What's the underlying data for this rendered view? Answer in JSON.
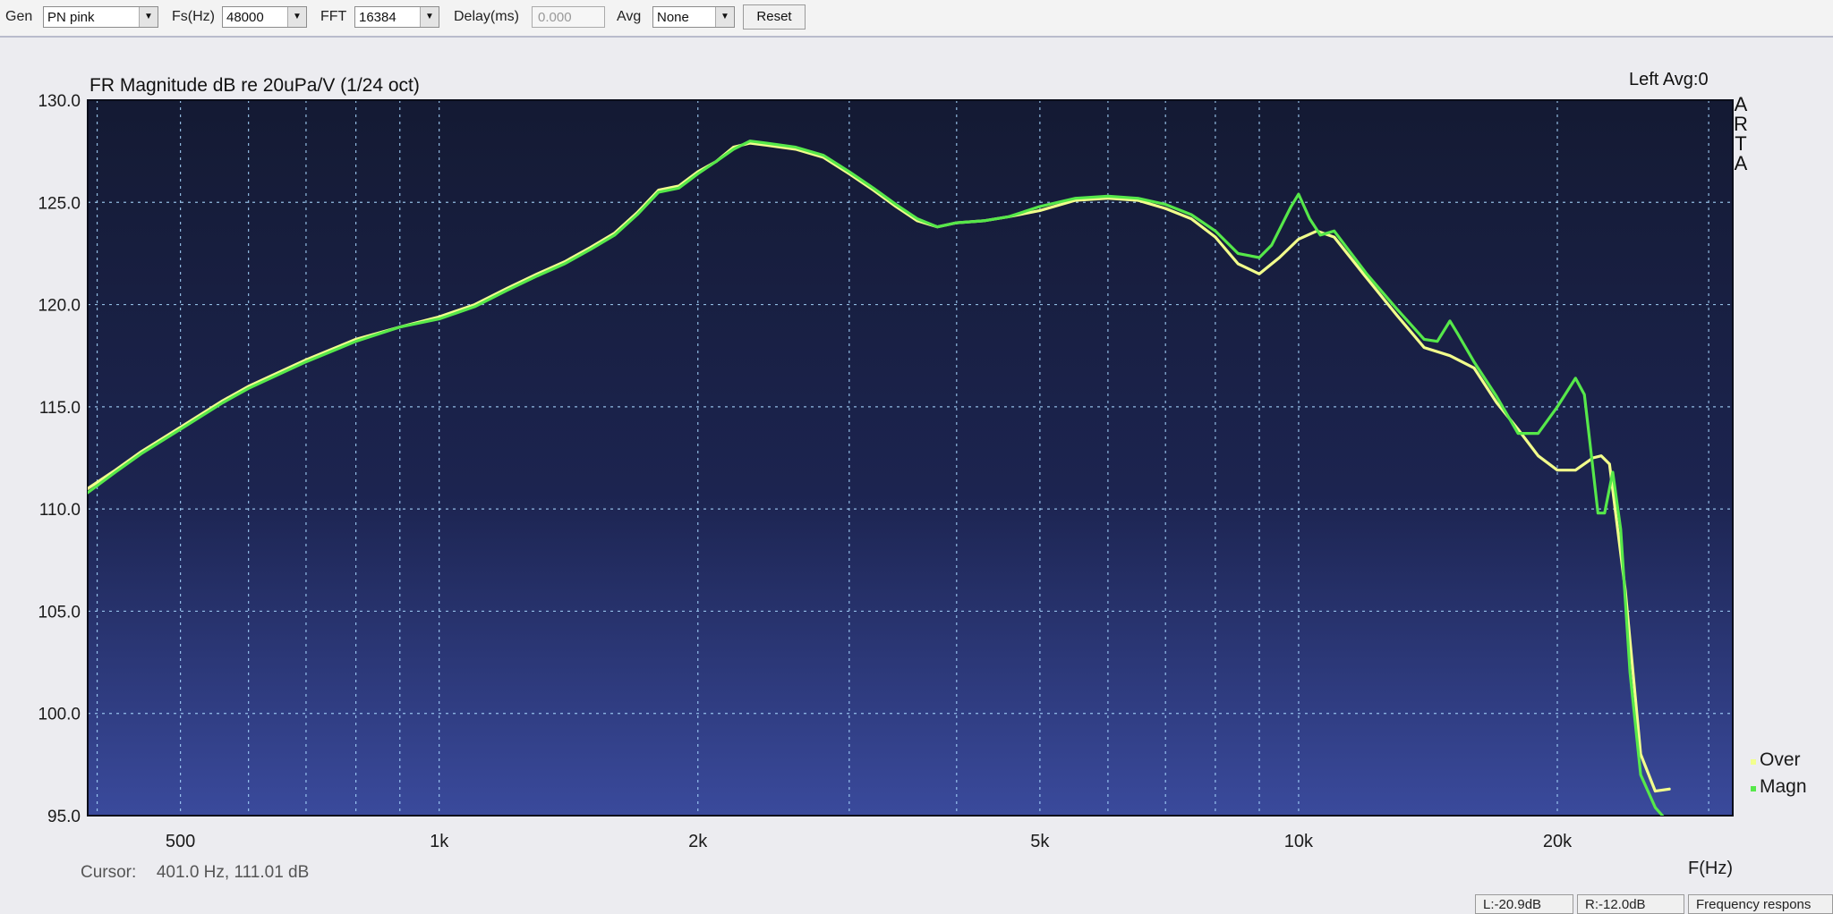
{
  "toolbar": {
    "gen_label": "Gen",
    "gen_value": "PN pink",
    "fs_label": "Fs(Hz)",
    "fs_value": "48000",
    "fft_label": "FFT",
    "fft_value": "16384",
    "delay_label": "Delay(ms)",
    "delay_value": "0.000",
    "avg_label": "Avg",
    "avg_value": "None",
    "reset_label": "Reset"
  },
  "header": {
    "right_title": "Left  Avg:0",
    "brand_letters": [
      "A",
      "R",
      "T",
      "A"
    ]
  },
  "cursor": {
    "label": "Cursor:",
    "value": "401.0 Hz, 111.01 dB"
  },
  "statusbar": {
    "left_level": "L:-20.9dB",
    "right_level": "R:-12.0dB",
    "mode": "Frequency respons"
  },
  "colors": {
    "plot_bg": "#1c2450",
    "grid": "#a8d8ff",
    "over": "#f2ff8c",
    "magn": "#56e84a",
    "axis_text": "#1a1a1a"
  },
  "chart_data": {
    "type": "line",
    "title": "FR Magnitude dB re 20uPa/V (1/24 oct)",
    "xlabel": "F(Hz)",
    "ylabel": "",
    "x_scale": "log",
    "xlim": [
      390,
      32000
    ],
    "ylim": [
      95,
      130
    ],
    "y_ticks": [
      95,
      100,
      105,
      110,
      115,
      120,
      125,
      130
    ],
    "y_tick_labels": [
      "95.0",
      "100.0",
      "105.0",
      "110.0",
      "115.0",
      "120.0",
      "125.0",
      "130.0"
    ],
    "x_tick_labels": [
      {
        "f": 500,
        "label": "500"
      },
      {
        "f": 1000,
        "label": "1k"
      },
      {
        "f": 2000,
        "label": "2k"
      },
      {
        "f": 5000,
        "label": "5k"
      },
      {
        "f": 10000,
        "label": "10k"
      },
      {
        "f": 20000,
        "label": "20k"
      }
    ],
    "grid": true,
    "legend_position": "right",
    "series": [
      {
        "name": "Over",
        "color": "#f2ff8c",
        "points": [
          [
            390,
            111.0
          ],
          [
            420,
            111.9
          ],
          [
            450,
            112.8
          ],
          [
            500,
            114.0
          ],
          [
            560,
            115.3
          ],
          [
            600,
            116.0
          ],
          [
            700,
            117.3
          ],
          [
            800,
            118.3
          ],
          [
            900,
            118.9
          ],
          [
            1000,
            119.4
          ],
          [
            1100,
            120.0
          ],
          [
            1200,
            120.8
          ],
          [
            1300,
            121.5
          ],
          [
            1400,
            122.1
          ],
          [
            1500,
            122.8
          ],
          [
            1600,
            123.5
          ],
          [
            1700,
            124.5
          ],
          [
            1800,
            125.6
          ],
          [
            1900,
            125.8
          ],
          [
            2000,
            126.5
          ],
          [
            2100,
            127.0
          ],
          [
            2200,
            127.7
          ],
          [
            2300,
            127.9
          ],
          [
            2400,
            127.8
          ],
          [
            2600,
            127.6
          ],
          [
            2800,
            127.2
          ],
          [
            3000,
            126.4
          ],
          [
            3200,
            125.6
          ],
          [
            3400,
            124.8
          ],
          [
            3600,
            124.1
          ],
          [
            3800,
            123.8
          ],
          [
            4000,
            124.0
          ],
          [
            4300,
            124.1
          ],
          [
            4600,
            124.3
          ],
          [
            5000,
            124.6
          ],
          [
            5500,
            125.1
          ],
          [
            6000,
            125.2
          ],
          [
            6500,
            125.1
          ],
          [
            7000,
            124.7
          ],
          [
            7500,
            124.2
          ],
          [
            8000,
            123.3
          ],
          [
            8500,
            122.0
          ],
          [
            9000,
            121.5
          ],
          [
            9500,
            122.3
          ],
          [
            10000,
            123.2
          ],
          [
            10500,
            123.6
          ],
          [
            11000,
            123.3
          ],
          [
            12000,
            121.3
          ],
          [
            13000,
            119.5
          ],
          [
            14000,
            117.9
          ],
          [
            15000,
            117.5
          ],
          [
            16000,
            116.9
          ],
          [
            17000,
            115.2
          ],
          [
            18000,
            113.9
          ],
          [
            19000,
            112.6
          ],
          [
            20000,
            111.9
          ],
          [
            21000,
            111.9
          ],
          [
            22000,
            112.5
          ],
          [
            22500,
            112.6
          ],
          [
            23000,
            112.2
          ],
          [
            24000,
            106.0
          ],
          [
            25000,
            98.0
          ],
          [
            26000,
            96.2
          ],
          [
            27000,
            96.3
          ]
        ]
      },
      {
        "name": "Magn",
        "color": "#56e84a",
        "points": [
          [
            390,
            110.8
          ],
          [
            420,
            111.8
          ],
          [
            450,
            112.7
          ],
          [
            500,
            113.9
          ],
          [
            560,
            115.2
          ],
          [
            600,
            115.9
          ],
          [
            700,
            117.2
          ],
          [
            800,
            118.2
          ],
          [
            900,
            118.9
          ],
          [
            1000,
            119.3
          ],
          [
            1100,
            119.9
          ],
          [
            1200,
            120.7
          ],
          [
            1300,
            121.4
          ],
          [
            1400,
            122.0
          ],
          [
            1500,
            122.7
          ],
          [
            1600,
            123.4
          ],
          [
            1700,
            124.4
          ],
          [
            1800,
            125.5
          ],
          [
            1900,
            125.7
          ],
          [
            2000,
            126.4
          ],
          [
            2100,
            127.0
          ],
          [
            2200,
            127.6
          ],
          [
            2300,
            128.0
          ],
          [
            2400,
            127.9
          ],
          [
            2600,
            127.7
          ],
          [
            2800,
            127.3
          ],
          [
            3000,
            126.5
          ],
          [
            3200,
            125.7
          ],
          [
            3400,
            124.9
          ],
          [
            3600,
            124.2
          ],
          [
            3800,
            123.8
          ],
          [
            4000,
            124.0
          ],
          [
            4300,
            124.1
          ],
          [
            4600,
            124.3
          ],
          [
            5000,
            124.8
          ],
          [
            5500,
            125.2
          ],
          [
            6000,
            125.3
          ],
          [
            6500,
            125.2
          ],
          [
            7000,
            124.9
          ],
          [
            7500,
            124.4
          ],
          [
            8000,
            123.6
          ],
          [
            8500,
            122.5
          ],
          [
            9000,
            122.3
          ],
          [
            9300,
            122.9
          ],
          [
            9800,
            124.8
          ],
          [
            10000,
            125.4
          ],
          [
            10300,
            124.2
          ],
          [
            10600,
            123.4
          ],
          [
            11000,
            123.6
          ],
          [
            12000,
            121.5
          ],
          [
            13000,
            119.8
          ],
          [
            14000,
            118.3
          ],
          [
            14500,
            118.2
          ],
          [
            15000,
            119.2
          ],
          [
            15300,
            118.6
          ],
          [
            16000,
            117.2
          ],
          [
            17000,
            115.5
          ],
          [
            18000,
            113.7
          ],
          [
            19000,
            113.7
          ],
          [
            20000,
            115.0
          ],
          [
            21000,
            116.4
          ],
          [
            21500,
            115.6
          ],
          [
            22000,
            112.0
          ],
          [
            22300,
            109.8
          ],
          [
            22700,
            109.8
          ],
          [
            23200,
            111.8
          ],
          [
            23700,
            109.0
          ],
          [
            24300,
            102.0
          ],
          [
            25000,
            97.0
          ],
          [
            26000,
            95.4
          ],
          [
            26500,
            95.0
          ]
        ]
      }
    ]
  }
}
